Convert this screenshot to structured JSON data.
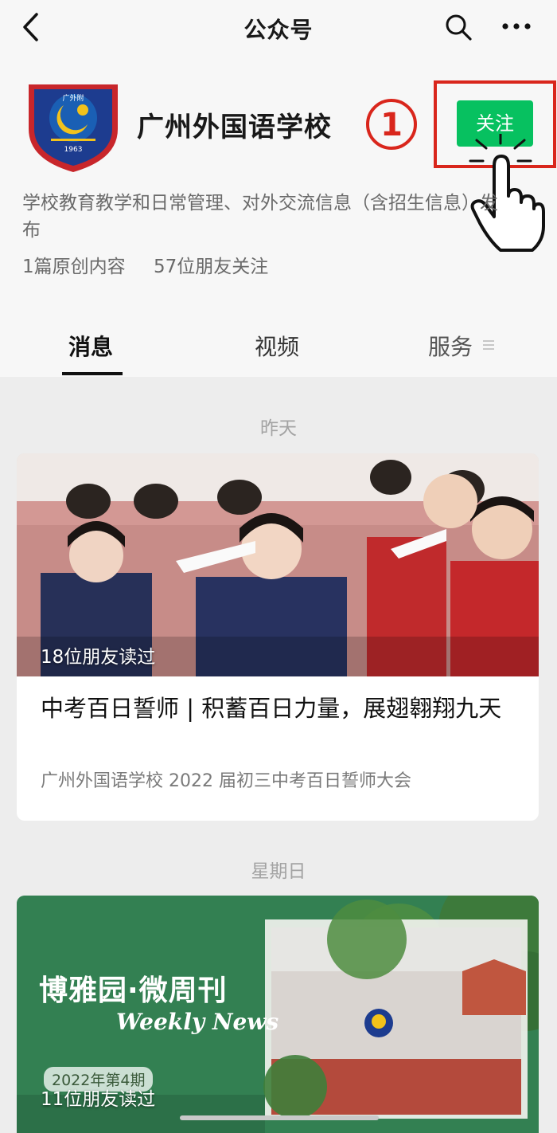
{
  "nav": {
    "title": "公众号"
  },
  "account": {
    "name": "广州外国语学校",
    "logo_text": "广外附",
    "logo_year": "1963",
    "description": "学校教育教学和日常管理、对外交流信息（含招生信息）发布",
    "stats": [
      "1篇原创内容",
      "57位朋友关注"
    ],
    "follow_label": "关注",
    "step_marker": "①"
  },
  "tabs": [
    {
      "label": "消息",
      "active": true
    },
    {
      "label": "视频",
      "active": false
    },
    {
      "label": "服务",
      "active": false
    }
  ],
  "feed": [
    {
      "date": "昨天",
      "read_count": "18位朋友读过",
      "title": "中考百日誓师 | 积蓄百日力量，展翅翱翔九天",
      "digest": "广州外国语学校 2022 届初三中考百日誓师大会"
    },
    {
      "date": "星期日",
      "read_count": "11位朋友读过",
      "cover_title": "博雅园·微周刊",
      "cover_subtitle": "Weekly News",
      "issue": "2022年第4期"
    }
  ],
  "colors": {
    "follow_green": "#07c160",
    "highlight_red": "#d9261c",
    "background": "#ededed"
  }
}
